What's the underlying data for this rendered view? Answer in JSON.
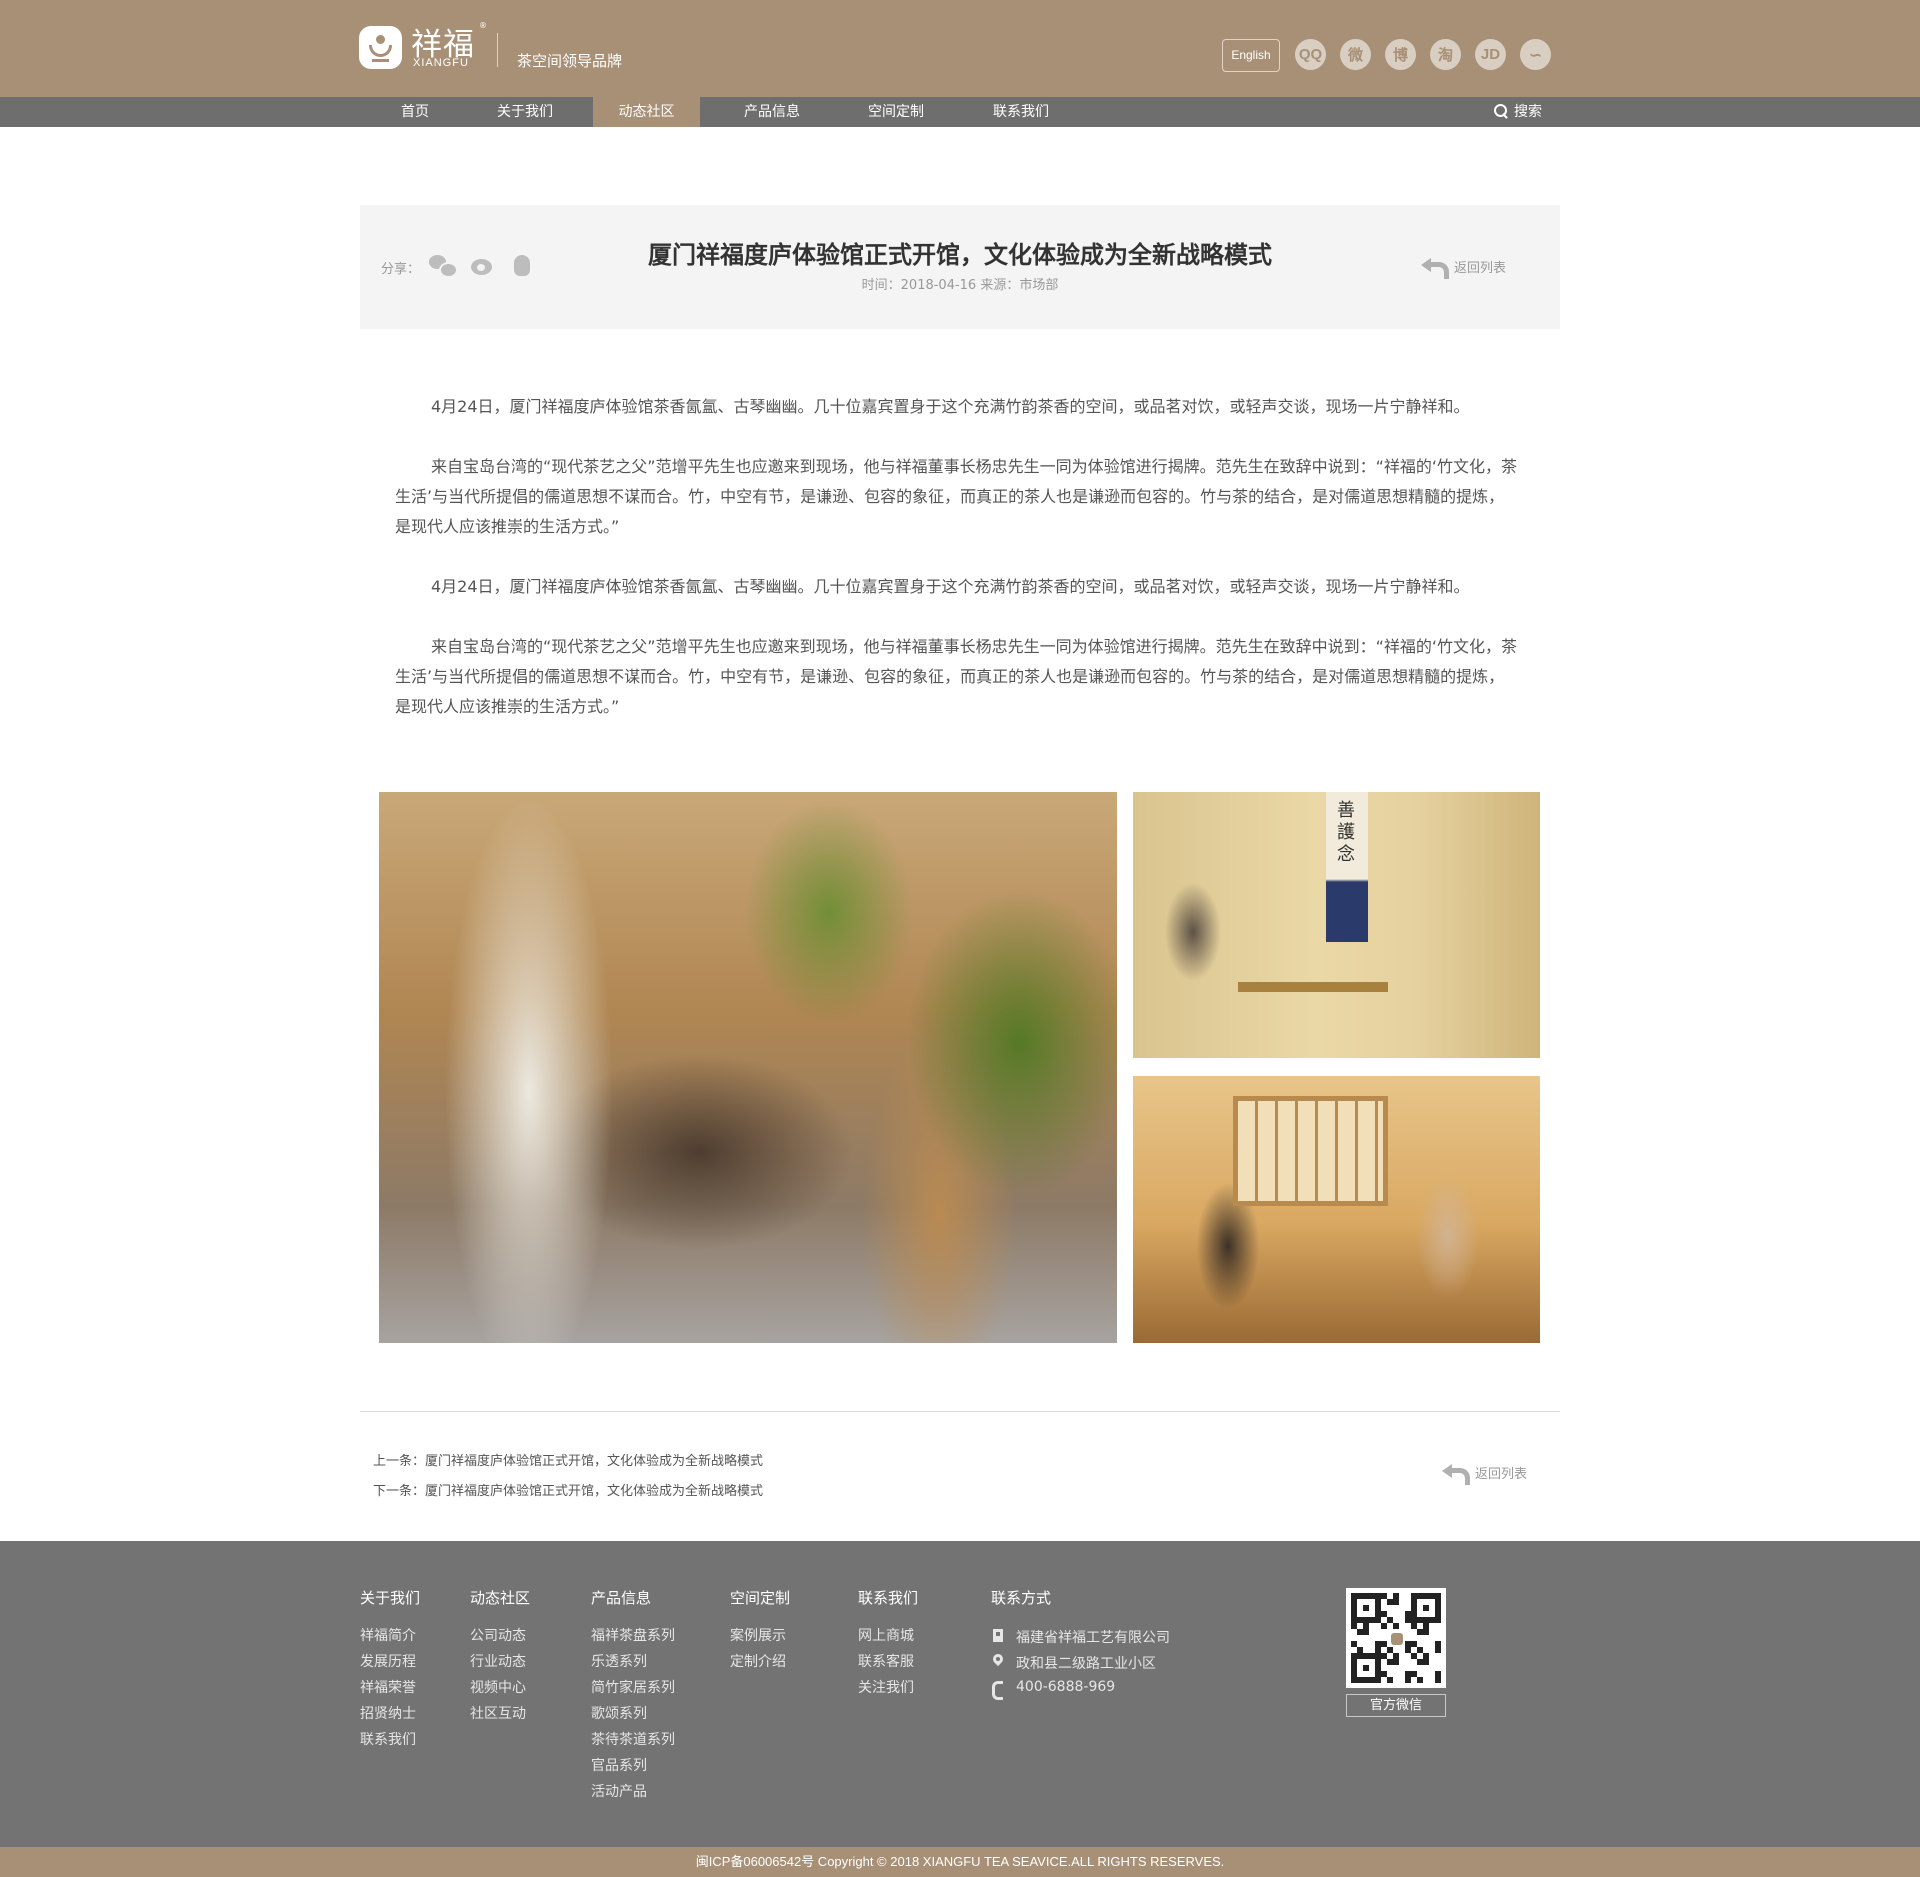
{
  "brand": {
    "name_cn": "祥福",
    "name_en": "XIANGFU",
    "registered": "®",
    "slogan": "茶空间领导品牌"
  },
  "header": {
    "lang_button": "English",
    "social_icons": [
      {
        "name": "qq-icon",
        "glyph": "QQ"
      },
      {
        "name": "wechat-icon",
        "glyph": "微"
      },
      {
        "name": "weibo-icon",
        "glyph": "博"
      },
      {
        "name": "taobao-icon",
        "glyph": "淘"
      },
      {
        "name": "jd-icon",
        "glyph": "JD"
      },
      {
        "name": "tmall-icon",
        "glyph": "∽"
      }
    ]
  },
  "nav": {
    "items": [
      "首页",
      "关于我们",
      "动态社区",
      "产品信息",
      "空间定制",
      "联系我们"
    ],
    "active": "动态社区",
    "search": "搜索"
  },
  "article": {
    "share_label": "分享：",
    "title": "厦门祥福度庐体验馆正式开馆，文化体验成为全新战略模式",
    "meta": "时间：2018-04-16   来源：市场部",
    "back_label": "返回列表",
    "paragraphs": [
      "4月24日，厦门祥福度庐体验馆茶香氤氲、古琴幽幽。几十位嘉宾置身于这个充满竹韵茶香的空间，或品茗对饮，或轻声交谈，现场一片宁静祥和。",
      "来自宝岛台湾的“现代茶艺之父”范增平先生也应邀来到现场，他与祥福董事长杨忠先生一同为体验馆进行揭牌。范先生在致辞中说到：“祥福的‘竹文化，茶生活’与当代所提倡的儒道思想不谋而合。竹，中空有节，是谦逊、包容的象征，而真正的茶人也是谦逊而包容的。竹与茶的结合，是对儒道思想精髓的提炼，是现代人应该推崇的生活方式。”",
      "4月24日，厦门祥福度庐体验馆茶香氤氲、古琴幽幽。几十位嘉宾置身于这个充满竹韵茶香的空间，或品茗对饮，或轻声交谈，现场一片宁静祥和。",
      "来自宝岛台湾的“现代茶艺之父”范增平先生也应邀来到现场，他与祥福董事长杨忠先生一同为体验馆进行揭牌。范先生在致辞中说到：“祥福的‘竹文化，茶生活’与当代所提倡的儒道思想不谋而合。竹，中空有节，是谦逊、包容的象征，而真正的茶人也是谦逊而包容的。竹与茶的结合，是对儒道思想精髓的提炼，是现代人应该推崇的生活方式。”"
    ],
    "scroll_text": "善護念"
  },
  "pager": {
    "prev": "上一条：厦门祥福度庐体验馆正式开馆，文化体验成为全新战略模式",
    "next": "下一条：厦门祥福度庐体验馆正式开馆，文化体验成为全新战略模式",
    "back_label": "返回列表"
  },
  "footer": {
    "columns": [
      {
        "title": "关于我们",
        "links": [
          "祥福简介",
          "发展历程",
          "祥福荣誉",
          "招贤纳士",
          "联系我们"
        ]
      },
      {
        "title": "动态社区",
        "links": [
          "公司动态",
          "行业动态",
          "视频中心",
          "社区互动"
        ]
      },
      {
        "title": "产品信息",
        "links": [
          "福祥茶盘系列",
          "乐透系列",
          "简竹家居系列",
          "歌颂系列",
          "茶待茶道系列",
          "官品系列",
          "活动产品"
        ]
      },
      {
        "title": "空间定制",
        "links": [
          "案例展示",
          "定制介绍"
        ]
      },
      {
        "title": "联系我们",
        "links": [
          "网上商城",
          "联系客服",
          "关注我们"
        ]
      }
    ],
    "contact": {
      "title": "联系方式",
      "company": "福建省祥福工艺有限公司",
      "address": "政和县二级路工业小区",
      "phone": "400-6888-969"
    },
    "qr_label": "官方微信"
  },
  "copyright": "闽ICP备06006542号 Copyright © 2018 XIANGFU TEA SEAVICE.ALL RIGHTS RESERVES.",
  "colors": {
    "brand": "#a89076",
    "nav": "#6e6e6e",
    "footer": "#737373"
  }
}
